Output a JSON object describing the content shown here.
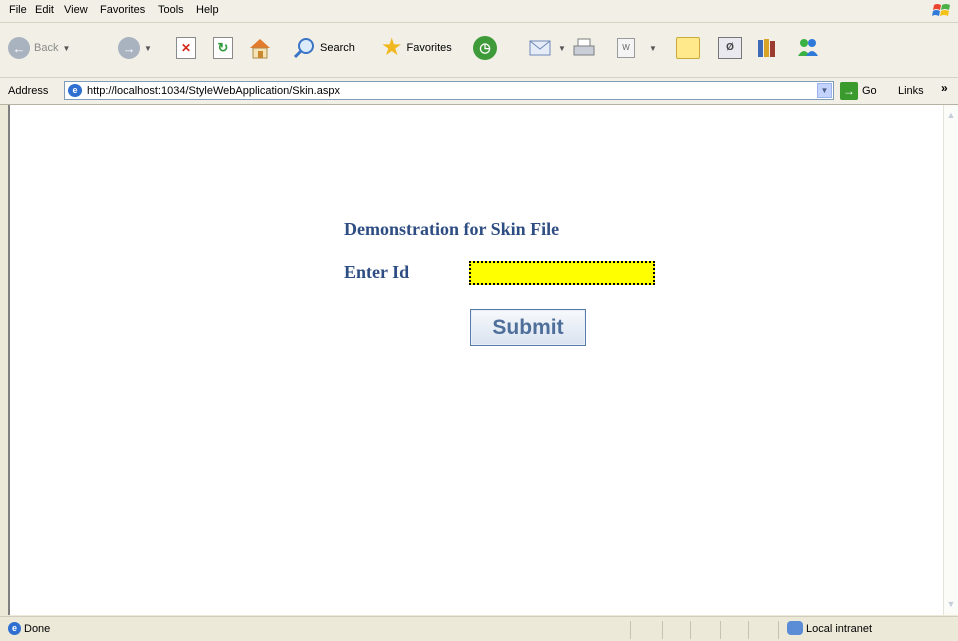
{
  "menu": [
    "File",
    "Edit",
    "View",
    "Favorites",
    "Tools",
    "Help"
  ],
  "toolbar": {
    "back_label": "Back",
    "search_label": "Search",
    "favorites_label": "Favorites"
  },
  "address": {
    "label": "Address",
    "url": "http://localhost:1034/StyleWebApplication/Skin.aspx",
    "go_label": "Go",
    "links_label": "Links",
    "more_glyph": "»"
  },
  "page": {
    "heading": "Demonstration for Skin File",
    "id_label": "Enter Id",
    "id_value": "",
    "submit_label": "Submit"
  },
  "status": {
    "text": "Done",
    "zone": "Local intranet"
  },
  "colors": {
    "heading": "#2e4d82",
    "input_bg": "#ffff00",
    "button_text": "#4f6f9b"
  }
}
